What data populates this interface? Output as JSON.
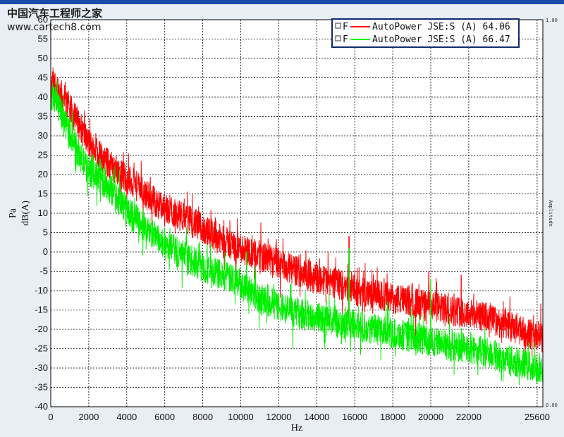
{
  "watermark": {
    "site_name": "中国汽车工程师之家",
    "url": "www.cartech8.com"
  },
  "colors": {
    "series1": "#ff0000",
    "series2": "#00ee00",
    "grid": "#000000",
    "legend_border": "#102a6e"
  },
  "chart_data": {
    "type": "line",
    "xlabel": "Hz",
    "ylabel_lines": [
      "Pa",
      "dB(A)"
    ],
    "right_ylabel": "Amplitude",
    "xlim": [
      0,
      25900
    ],
    "ylim": [
      -40,
      60
    ],
    "right_ylim": [
      0.0,
      1.0
    ],
    "right_ticks": [
      "1.00",
      "0.00"
    ],
    "xticks": [
      0,
      2000,
      4000,
      6000,
      8000,
      10000,
      12000,
      14000,
      16000,
      18000,
      20000,
      22000,
      25600
    ],
    "yticks": [
      -40,
      -35,
      -30,
      -25,
      -20,
      -15,
      -10,
      -5,
      0,
      5,
      10,
      15,
      20,
      25,
      30,
      35,
      40,
      45,
      50,
      55,
      60
    ],
    "grid": true,
    "legend_position": "top-right",
    "series": [
      {
        "name": "AutoPower JSE:S (A) 64.06",
        "marker": "F",
        "color": "#ff0000",
        "noise_amplitude": 4,
        "x": [
          0,
          100,
          300,
          500,
          1000,
          1500,
          2000,
          3000,
          4000,
          5000,
          6000,
          7000,
          8000,
          9000,
          10000,
          11000,
          12000,
          13000,
          14000,
          15000,
          16000,
          17000,
          18000,
          19000,
          20000,
          21000,
          22000,
          23000,
          24000,
          25000,
          25900
        ],
        "y": [
          40,
          44,
          43,
          41,
          37,
          33,
          28,
          23,
          19,
          15,
          11,
          9,
          6,
          3,
          1,
          -1,
          -3,
          -5,
          -7,
          -8,
          -10,
          -11,
          -12,
          -13,
          -14,
          -15,
          -16,
          -17,
          -19,
          -21,
          -22
        ]
      },
      {
        "name": "AutoPower JSE:S (A) 66.47",
        "marker": "F",
        "color": "#00ee00",
        "noise_amplitude": 4,
        "x": [
          0,
          100,
          300,
          500,
          1000,
          1500,
          2000,
          3000,
          4000,
          5000,
          6000,
          7000,
          8000,
          9000,
          10000,
          11000,
          12000,
          13000,
          14000,
          15000,
          16000,
          17000,
          18000,
          19000,
          20000,
          21000,
          22000,
          23000,
          24000,
          25000,
          25900
        ],
        "y": [
          36,
          40,
          39,
          36,
          31,
          25,
          21,
          17,
          11,
          6,
          2,
          -1,
          -4,
          -6,
          -8,
          -12,
          -14,
          -16,
          -17,
          -18,
          -19,
          -20,
          -21,
          -22,
          -23,
          -24,
          -25,
          -26,
          -28,
          -29,
          -31
        ]
      }
    ],
    "peaks": [
      {
        "series": 0,
        "x": 15700,
        "y": 4
      },
      {
        "series": 1,
        "x": 15700,
        "y": 1
      },
      {
        "series": 0,
        "x": 19900,
        "y": -5
      },
      {
        "series": 1,
        "x": 20000,
        "y": -7
      },
      {
        "series": 0,
        "x": 21600,
        "y": -6
      },
      {
        "series": 1,
        "x": 10300,
        "y": 0
      },
      {
        "series": 1,
        "x": 2600,
        "y": 24
      },
      {
        "series": 0,
        "x": 4600,
        "y": 20
      },
      {
        "series": 1,
        "x": 7800,
        "y": 2
      }
    ]
  }
}
